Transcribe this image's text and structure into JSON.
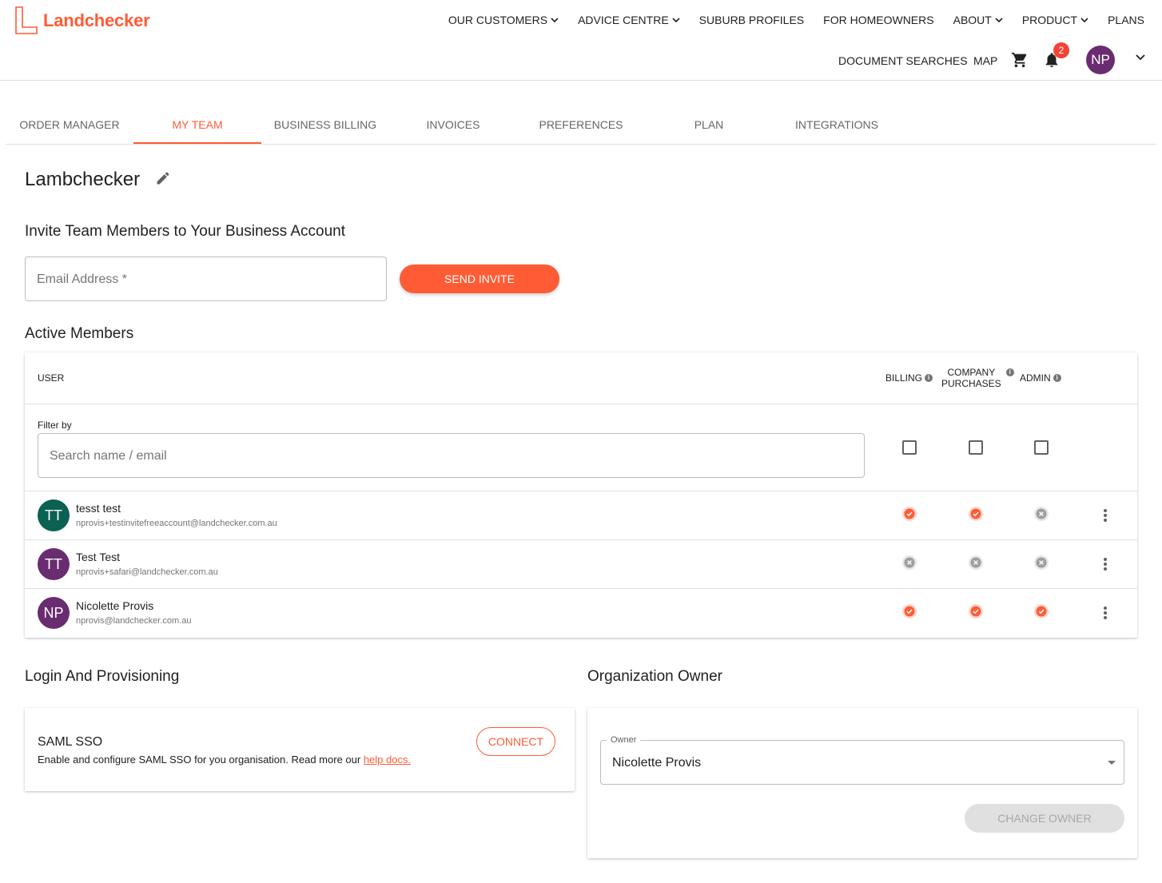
{
  "brand": {
    "name": "Landchecker",
    "accent": "#ff5c35"
  },
  "top_nav": [
    {
      "label": "OUR CUSTOMERS",
      "dropdown": true
    },
    {
      "label": "ADVICE CENTRE",
      "dropdown": true
    },
    {
      "label": "SUBURB PROFILES",
      "dropdown": false
    },
    {
      "label": "FOR HOMEOWNERS",
      "dropdown": false
    },
    {
      "label": "ABOUT",
      "dropdown": true
    },
    {
      "label": "PRODUCT",
      "dropdown": true
    },
    {
      "label": "PLANS",
      "dropdown": false
    }
  ],
  "sub_nav": {
    "document_searches": "DOCUMENT SEARCHES",
    "map": "MAP",
    "notification_count": "2",
    "user_initials": "NP",
    "icons": [
      "cart-icon",
      "bell-icon",
      "chevron-down-icon"
    ]
  },
  "tabs": [
    "ORDER MANAGER",
    "MY TEAM",
    "BUSINESS BILLING",
    "INVOICES",
    "PREFERENCES",
    "PLAN",
    "INTEGRATIONS"
  ],
  "active_tab": "MY TEAM",
  "team": {
    "name": "Lambchecker"
  },
  "invite": {
    "title": "Invite Team Members to Your Business Account",
    "email_placeholder": "Email Address *",
    "send_label": "SEND INVITE"
  },
  "members": {
    "title": "Active Members",
    "col_user": "USER",
    "col_billing": "BILLING",
    "col_company_purchases_1": "COMPANY",
    "col_company_purchases_2": "PURCHASES",
    "col_admin": "ADMIN",
    "filter_label": "Filter by",
    "search_placeholder": "Search name / email",
    "rows": [
      {
        "initials": "TT",
        "avatar_color": "#0b6152",
        "name": "tesst test",
        "email": "nprovis+testinvitefreeaccount@landchecker.com.au",
        "billing": true,
        "company_purchases": true,
        "admin": false
      },
      {
        "initials": "TT",
        "avatar_color": "#6a2c70",
        "name": "Test Test",
        "email": "nprovis+safari@landchecker.com.au",
        "billing": false,
        "company_purchases": false,
        "admin": false
      },
      {
        "initials": "NP",
        "avatar_color": "#6a2c70",
        "name": "Nicolette Provis",
        "email": "nprovis@landchecker.com.au",
        "billing": true,
        "company_purchases": true,
        "admin": true
      }
    ]
  },
  "login": {
    "title": "Login And Provisioning",
    "saml_title": "SAML SSO",
    "saml_desc": "Enable and configure SAML SSO for you organisation. Read more our ",
    "help_link": "help docs.",
    "connect_label": "CONNECT"
  },
  "owner": {
    "title": "Organization Owner",
    "field_label": "Owner",
    "selected": "Nicolette Provis",
    "change_label": "CHANGE OWNER"
  }
}
